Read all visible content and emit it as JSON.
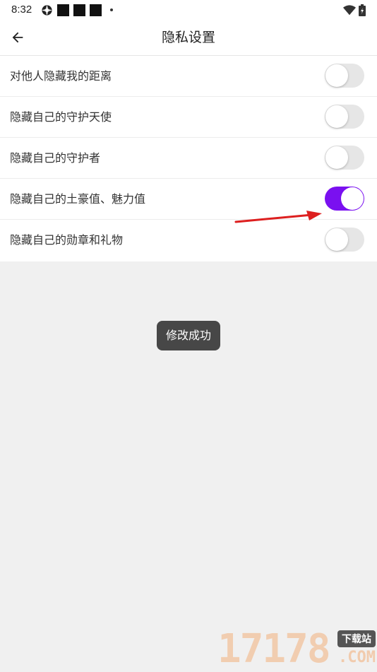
{
  "status_bar": {
    "time": "8:32",
    "icons": [
      "settings-icon",
      "notification-square-icon",
      "notification-square-icon",
      "notification-square-icon",
      "more-dot-icon",
      "wifi-icon",
      "battery-icon"
    ]
  },
  "header": {
    "title": "隐私设置",
    "back_icon": "arrow-left-icon"
  },
  "settings": {
    "items": [
      {
        "label": "对他人隐藏我的距离",
        "enabled": false
      },
      {
        "label": "隐藏自己的守护天使",
        "enabled": false
      },
      {
        "label": "隐藏自己的守护者",
        "enabled": false
      },
      {
        "label": "隐藏自己的土豪值、魅力值",
        "enabled": true
      },
      {
        "label": "隐藏自己的勋章和礼物",
        "enabled": false
      }
    ]
  },
  "toast": {
    "message": "修改成功"
  },
  "watermark": {
    "digits": "17178",
    "tag": "下载站",
    "suffix": ".COM"
  },
  "colors": {
    "accent": "#7a10f0",
    "toggle_off": "#e6e6e6",
    "background": "#f0f0f0",
    "toast_bg": "#474747",
    "annotation": "#dd1f1f"
  }
}
